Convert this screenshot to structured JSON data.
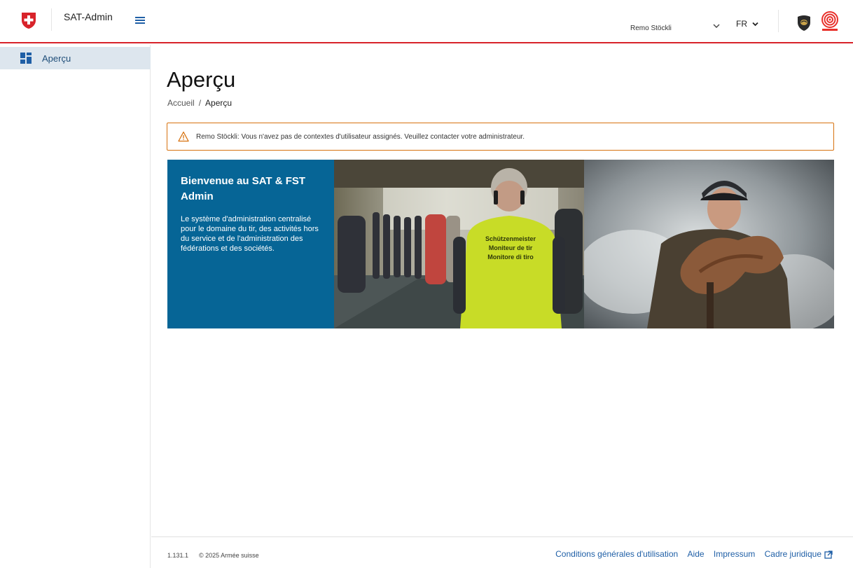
{
  "header": {
    "app_title": "SAT-Admin",
    "user_name": "Remo Stöckli",
    "language": "FR",
    "accent_color": "#d8232a"
  },
  "sidebar": {
    "items": [
      {
        "label": "Aperçu",
        "icon": "dashboard-icon"
      }
    ]
  },
  "main": {
    "page_title": "Aperçu",
    "breadcrumb": {
      "home": "Accueil",
      "separator": "/",
      "current": "Aperçu"
    },
    "alert": {
      "message": "Remo Stöckli: Vous n'avez pas de contextes d'utilisateur assignés. Veuillez contacter votre administrateur.",
      "color": "#d7720f"
    },
    "hero": {
      "title": "Bienvenue au SAT & FST Admin",
      "description": "Le système d'administration centralisé pour le domaine du tir, des activités hors du service et de l'administration des fédérations et des sociétés.",
      "vest_lines": [
        "Schützenmeister",
        "Moniteur de tir",
        "Monitore di tiro"
      ],
      "panel_color": "#066596"
    }
  },
  "footer": {
    "version": "1.131.1",
    "copyright": "© 2025 Armée suisse",
    "links": [
      "Conditions générales d'utilisation",
      "Aide",
      "Impressum",
      "Cadre juridique"
    ]
  }
}
